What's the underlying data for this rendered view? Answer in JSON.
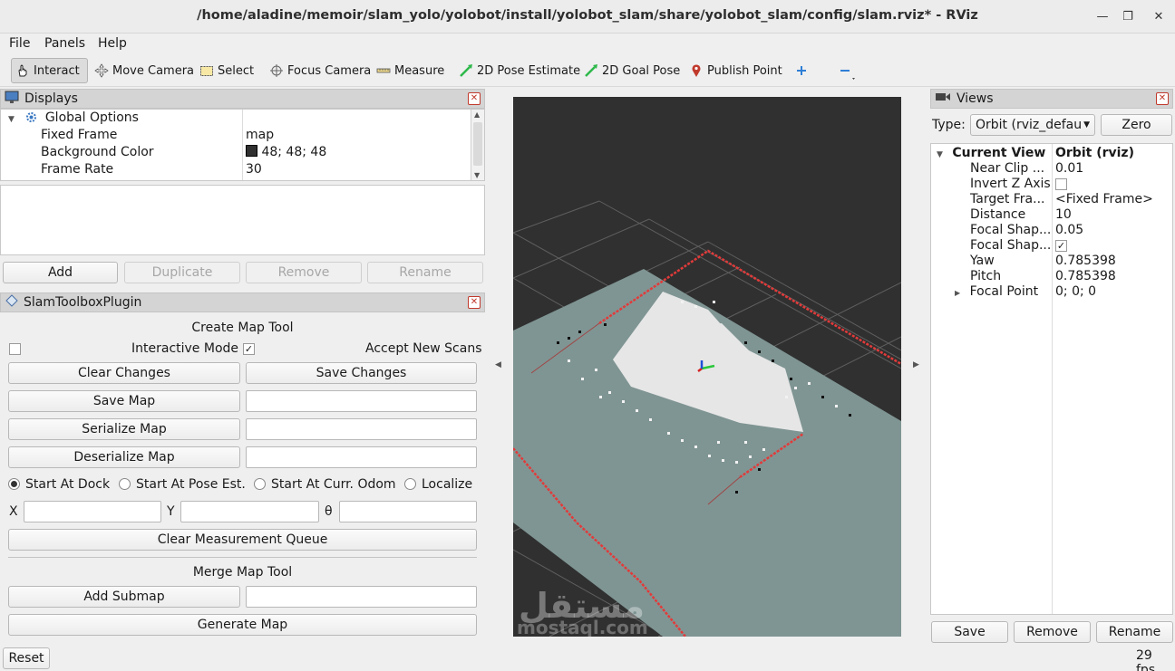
{
  "window": {
    "title": "/home/aladine/memoir/slam_yolo/yolobot/install/yolobot_slam/share/yolobot_slam/config/slam.rviz* - RViz"
  },
  "menu": {
    "file": "File",
    "panels": "Panels",
    "help": "Help"
  },
  "toolbar": {
    "interact": "Interact",
    "move_camera": "Move Camera",
    "select": "Select",
    "focus_camera": "Focus Camera",
    "measure": "Measure",
    "pose_estimate": "2D Pose Estimate",
    "goal_pose": "2D Goal Pose",
    "publish_point": "Publish Point"
  },
  "displays": {
    "title": "Displays",
    "global_options": "Global Options",
    "rows": [
      {
        "name": "Fixed Frame",
        "value": "map"
      },
      {
        "name": "Background Color",
        "value": "48; 48; 48",
        "swatch": "#303030"
      },
      {
        "name": "Frame Rate",
        "value": "30"
      }
    ],
    "buttons": {
      "add": "Add",
      "duplicate": "Duplicate",
      "remove": "Remove",
      "rename": "Rename"
    }
  },
  "slam": {
    "title": "SlamToolboxPlugin",
    "create_map_tool": "Create Map Tool",
    "interactive_mode": "Interactive Mode",
    "accept_new_scans": "Accept New Scans",
    "clear_changes": "Clear Changes",
    "save_changes": "Save Changes",
    "save_map": "Save Map",
    "serialize_map": "Serialize Map",
    "deserialize_map": "Deserialize Map",
    "start_at_dock": "Start At Dock",
    "start_at_pose": "Start At Pose Est.",
    "start_at_odom": "Start At Curr. Odom",
    "localize": "Localize",
    "x_label": "X",
    "y_label": "Y",
    "theta_label": "θ",
    "clear_queue": "Clear Measurement Queue",
    "merge_map_tool": "Merge Map Tool",
    "add_submap": "Add Submap",
    "generate_map": "Generate Map"
  },
  "views": {
    "title": "Views",
    "type_label": "Type:",
    "type_value": "Orbit (rviz_defau",
    "zero": "Zero",
    "current_view": "Current View",
    "current_view_value": "Orbit (rviz)",
    "props": [
      {
        "name": "Near Clip ...",
        "value": "0.01"
      },
      {
        "name": "Invert Z Axis",
        "value": ""
      },
      {
        "name": "Target Fra...",
        "value": "<Fixed Frame>"
      },
      {
        "name": "Distance",
        "value": "10"
      },
      {
        "name": "Focal Shap...",
        "value": "0.05"
      },
      {
        "name": "Focal Shap...",
        "value": ""
      },
      {
        "name": "Yaw",
        "value": "0.785398"
      },
      {
        "name": "Pitch",
        "value": "0.785398"
      },
      {
        "name": "Focal Point",
        "value": "0; 0; 0"
      }
    ],
    "save": "Save",
    "remove": "Remove",
    "rename": "Rename"
  },
  "status": {
    "reset": "Reset",
    "fps": "29 fps"
  },
  "watermark": {
    "arabic": "مستقل",
    "latin": "mostaql.com"
  }
}
